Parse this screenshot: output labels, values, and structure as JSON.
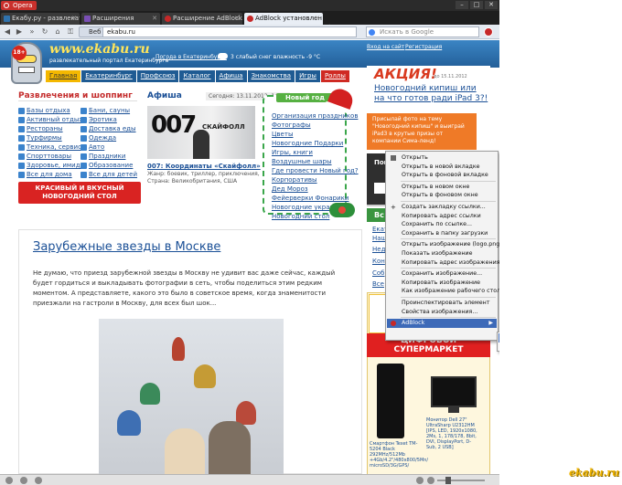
{
  "browser": {
    "menu_label": "Opera",
    "window_buttons": [
      "–",
      "□",
      "✕"
    ],
    "tabs": [
      {
        "title": "Екабу.ру - развлекате...",
        "active": false,
        "favicon": "#2f72ad"
      },
      {
        "title": "Расширения",
        "active": false,
        "favicon": "#7a4fb5"
      },
      {
        "title": "Расширение AdBlock ...",
        "active": false,
        "favicon": "#c62828"
      },
      {
        "title": "AdBlock установлен!",
        "active": true,
        "favicon": "#c62828"
      }
    ],
    "web_label": "Веб",
    "url": "ekabu.ru",
    "search_placeholder": "Искать в Google"
  },
  "header": {
    "age_badge": "18+",
    "logo": "www.ekabu.ru",
    "tagline": "развлекательный портал Екатеринбурга",
    "weather_link": "Погода в Екатеринбурге",
    "weather_text": "3 слабый снег  влажность -9 °C",
    "login": "Вход на сайт",
    "register": "Регистрация"
  },
  "nav": [
    {
      "label": "Главная",
      "style": "active"
    },
    {
      "label": "Екатеринбург",
      "style": ""
    },
    {
      "label": "Профсоюз",
      "style": ""
    },
    {
      "label": "Каталог",
      "style": ""
    },
    {
      "label": "Афиша",
      "style": ""
    },
    {
      "label": "Знакомства",
      "style": ""
    },
    {
      "label": "Игры",
      "style": ""
    },
    {
      "label": "Роллы",
      "style": "red"
    }
  ],
  "entertainment": {
    "title": "Развлечения и шоппинг",
    "col1": [
      "Базы отдыха",
      "Активный отдых",
      "Рестораны",
      "Турфирмы",
      "Техника, сервис",
      "Спорттовары",
      "Здоровье, имидж",
      "Все для дома"
    ],
    "col2": [
      "Бани, сауны",
      "Эротика",
      "Доставка еды",
      "Одежда",
      "Авто",
      "Праздники",
      "Образование",
      "Все для детей"
    ],
    "promo": "КРАСИВЫЙ И ВКУСНЫЙ НОВОГОДНИЙ СТОЛ"
  },
  "afisha": {
    "title": "Афиша",
    "date": "Сегодня: 13.11.2012, 14:38",
    "poster_title": "007",
    "poster_subtitle": "СКАЙФОЛЛ",
    "movie_title": "007: Координаты «Скайфолл»",
    "genre": "Жанр: боевик, триллер, приключения,",
    "country": "Страна: Великобритания, США"
  },
  "new_year": {
    "title": "Новый год",
    "links": [
      "Организация праздников",
      "Фотографы",
      "Цветы",
      "Новогодние Подарки",
      "Игры, книги",
      "Воздушные шары",
      "Где провести Новый год?",
      "Корпоративы",
      "Дед Мороз",
      "Фейерверки Фонарики",
      "Новогодние украшения",
      "Новогодний стол"
    ]
  },
  "sidebar": {
    "akcia_title": "АКЦИЯ!",
    "akcia_date": "до 15.11.2012",
    "akcia_link": "Новогодний кипиш или на что готов ради iPad 3?!",
    "orange_text": "Присылай фото на тему \"Новогодний кипиш\" и выиграй iPad3 в крутые призы от компании Сима-ленд!",
    "dark_title": "Пог",
    "green_label": "Вс",
    "side_links": [
      "Екат",
      "Наш",
      "Нед",
      "Кон",
      "Соб",
      "Все"
    ],
    "shop_title": "ЦИФРОВОЙ СУПЕРМАРКЕТ",
    "phone_caption": "Смартфон Texet TM-5204 Black 292MHz/512Mb +4Gb/4.2\"/480x800/5Mn/ microSD/3G/GPS/",
    "monitor_caption": "Монитор Dell 27\" UltraSharp U2312HM [IPS, LED, 1920x1080, 2Ms, 1, 178/178, 8bit, DVI, DisplayPort, D-Sub, 2 USB]"
  },
  "article": {
    "title": "Зарубежные звезды в Москве",
    "text": "Не думаю, что приезд зарубежной звезды в Москву не удивит вас даже сейчас, каждый будет гордиться и выкладывать фотографии в сеть, чтобы поделиться этим редким моментом. А представляете, какого это было в советское время, когда знаменитости приезжали на гастроли в Москву, для всех был шок..."
  },
  "context_menu": {
    "items": [
      {
        "label": "Открыть",
        "icon": "open-icon"
      },
      {
        "label": "Открыть в новой вкладке"
      },
      {
        "label": "Открыть в фоновой вкладке"
      },
      {
        "sep": true
      },
      {
        "label": "Открыть в новом окне"
      },
      {
        "label": "Открыть в фоновом окне"
      },
      {
        "sep": true
      },
      {
        "label": "Создать закладку ссылки...",
        "icon": "bookmark-plus-icon"
      },
      {
        "label": "Копировать адрес ссылки"
      },
      {
        "label": "Сохранить по ссылке..."
      },
      {
        "label": "Сохранить в папку загрузки"
      },
      {
        "sep": true
      },
      {
        "label": "Открыть изображение (logo.png)"
      },
      {
        "label": "Показать изображение"
      },
      {
        "label": "Копировать адрес изображения"
      },
      {
        "sep": true
      },
      {
        "label": "Сохранить изображение..."
      },
      {
        "label": "Копировать изображение"
      },
      {
        "label": "Как изображение рабочего стола"
      },
      {
        "sep": true
      },
      {
        "label": "Проинспектировать элемент"
      },
      {
        "label": "Свойства изображения..."
      },
      {
        "sep": true
      },
      {
        "label": "AdBlock",
        "icon": "adblock-icon",
        "submenu": true,
        "highlight": true
      }
    ],
    "submenu": [
      {
        "label": "Блокировать эту рекламу",
        "highlight": true
      },
      {
        "label": "Блокировать рекламу на этой странице"
      }
    ]
  },
  "watermark": "ekabu.ru",
  "colors": {
    "header_blue": "#2f72ad",
    "nav_yellow": "#f4b800",
    "accent_red": "#d92322",
    "link_blue": "#1a4f96",
    "menu_highlight": "#3d6ab8"
  }
}
